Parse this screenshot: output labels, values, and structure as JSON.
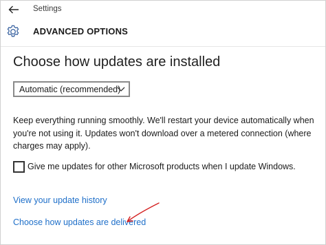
{
  "window": {
    "app_title": "Settings",
    "back_icon": "arrow-left-icon"
  },
  "header": {
    "icon": "gear-icon",
    "title": "ADVANCED OPTIONS"
  },
  "main": {
    "section_title": "Choose how updates are installed",
    "install_mode": {
      "selected": "Automatic (recommended)",
      "icon": "chevron-down-icon"
    },
    "description": "Keep everything running smoothly. We'll restart your device automatically when you're not using it. Updates won't download over a metered connection (where charges may apply).",
    "other_products": {
      "label": "Give me updates for other Microsoft products when I update Windows.",
      "checked": false
    },
    "links": {
      "history": "View your update history",
      "delivered": "Choose how updates are delivered"
    }
  },
  "colors": {
    "link": "#1e6fc9",
    "annotation": "#d42020"
  }
}
